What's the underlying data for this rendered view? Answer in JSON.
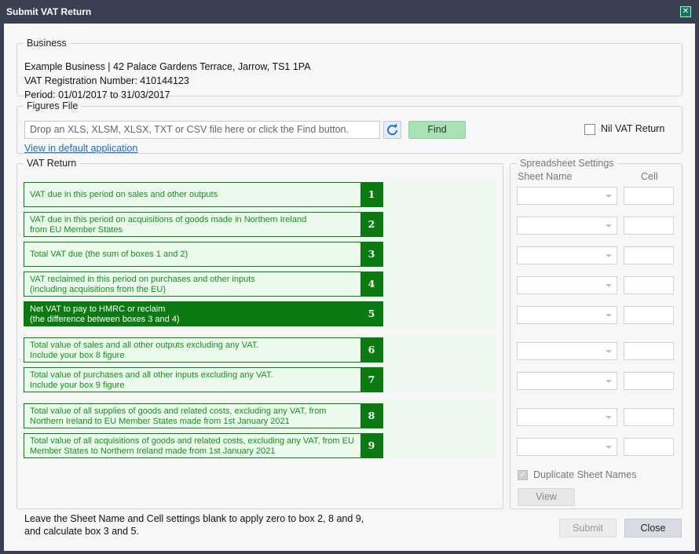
{
  "window": {
    "title": "Submit VAT Return",
    "close_glyph": "✕"
  },
  "business": {
    "legend": "Business",
    "name_address": "Example Business | 42 Palace Gardens Terrace, Jarrow, TS1 1PA",
    "vat_reg": "VAT Registration Number: 410144123",
    "period": "Period: 01/01/2017 to 31/03/2017"
  },
  "figures_file": {
    "legend": "Figures File",
    "placeholder": "Drop an XLS, XLSM, XLSX, TXT or CSV file here or click the Find button.",
    "refresh_icon": "refresh-icon",
    "find_label": "Find",
    "view_link": "View in default application",
    "nil_label": "Nil VAT Return",
    "nil_checked": false
  },
  "vat_return": {
    "legend": "VAT Return",
    "boxes": [
      {
        "number": "1",
        "line1": "VAT due in this period on sales and other outputs",
        "line2": ""
      },
      {
        "number": "2",
        "line1": "VAT due in this period on acquisitions of goods made in Northern Ireland",
        "line2": "from EU Member States"
      },
      {
        "number": "3",
        "line1": "Total VAT due (the sum of boxes 1 and 2)",
        "line2": ""
      },
      {
        "number": "4",
        "line1": "VAT reclaimed in this period on purchases and other inputs",
        "line2": "(including acquisitions from the EU)"
      },
      {
        "number": "5",
        "line1": "Net VAT to pay to HMRC or reclaim",
        "line2": "(the difference between boxes 3 and 4)"
      },
      {
        "number": "6",
        "line1": "Total value of sales and all other outputs excluding any VAT.",
        "line2": "Include your box 8 figure"
      },
      {
        "number": "7",
        "line1": "Total value of purchases and all other inputs excluding any VAT.",
        "line2": "Include your box 9 figure"
      },
      {
        "number": "8",
        "line1": "Total value of all supplies of goods and related costs, excluding any VAT, from",
        "line2": "Northern Ireland to EU Member States made from 1st January 2021"
      },
      {
        "number": "9",
        "line1": "Total value of all acquisitions of goods and related costs, excluding any VAT, from EU",
        "line2": "Member States to Northern Ireland made from 1st January 2021"
      }
    ]
  },
  "spreadsheet_settings": {
    "legend": "Spreadsheet Settings",
    "sheet_name_header": "Sheet Name",
    "cell_header": "Cell",
    "duplicate_label": "Duplicate Sheet Names",
    "duplicate_checked": true,
    "view_label": "View"
  },
  "footer": {
    "hint_line1": "Leave the Sheet Name and Cell settings blank to apply zero to box 2, 8 and 9,",
    "hint_line2": "and calculate box 3 and 5.",
    "submit_label": "Submit",
    "close_label": "Close"
  },
  "colors": {
    "title_bar": "#3b3f52",
    "box_green": "#0c7a12",
    "box_text_green": "#11921a",
    "find_button": "#a8e2b4"
  }
}
